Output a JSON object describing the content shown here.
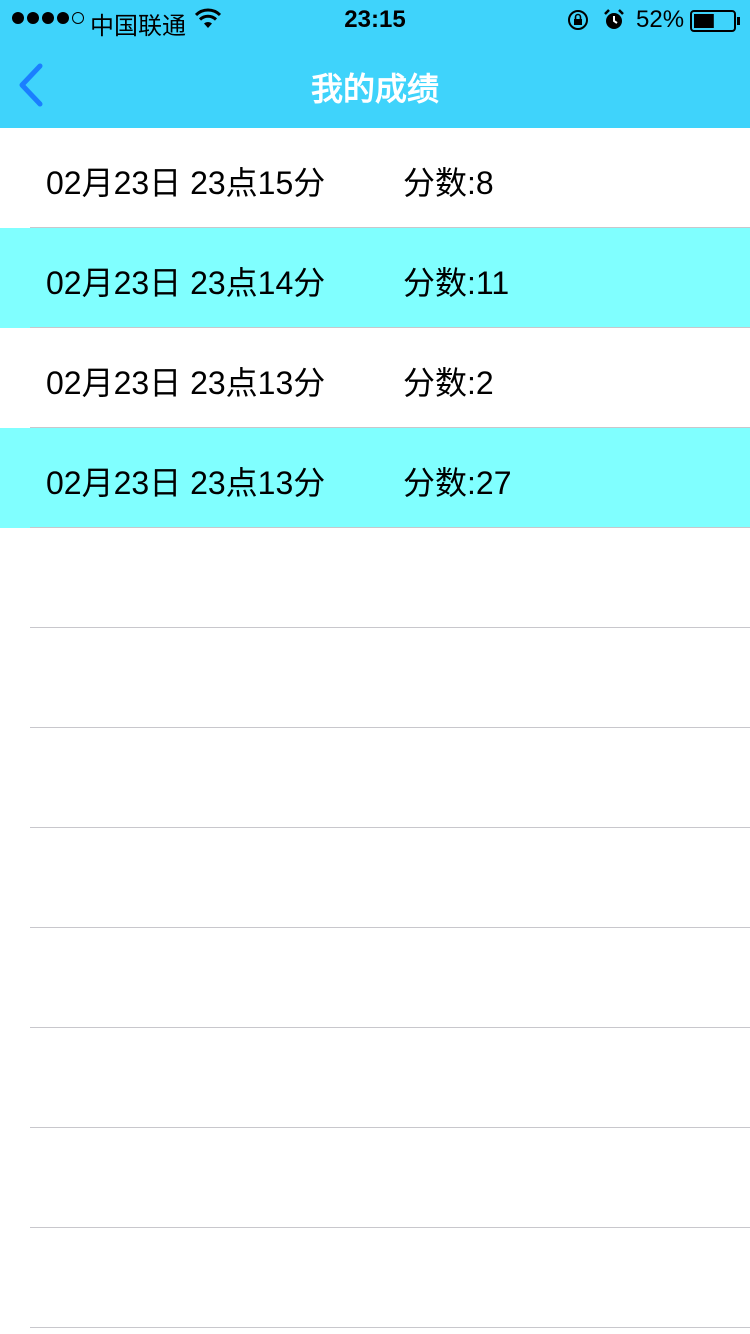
{
  "status_bar": {
    "carrier": "中国联通",
    "time": "23:15",
    "battery": "52%",
    "battery_level": 0.52
  },
  "nav": {
    "title": "我的成绩",
    "back_icon": "chevron-left-icon"
  },
  "records": [
    {
      "date": "02月23日 23点15分",
      "score": "分数:8"
    },
    {
      "date": "02月23日 23点14分",
      "score": "分数:11"
    },
    {
      "date": "02月23日 23点13分",
      "score": "分数:2"
    },
    {
      "date": "02月23日 23点13分",
      "score": "分数:27"
    }
  ],
  "colors": {
    "header": "#3fd3fb",
    "alt_row": "#80ffff",
    "back_icon": "#1a7fff"
  }
}
